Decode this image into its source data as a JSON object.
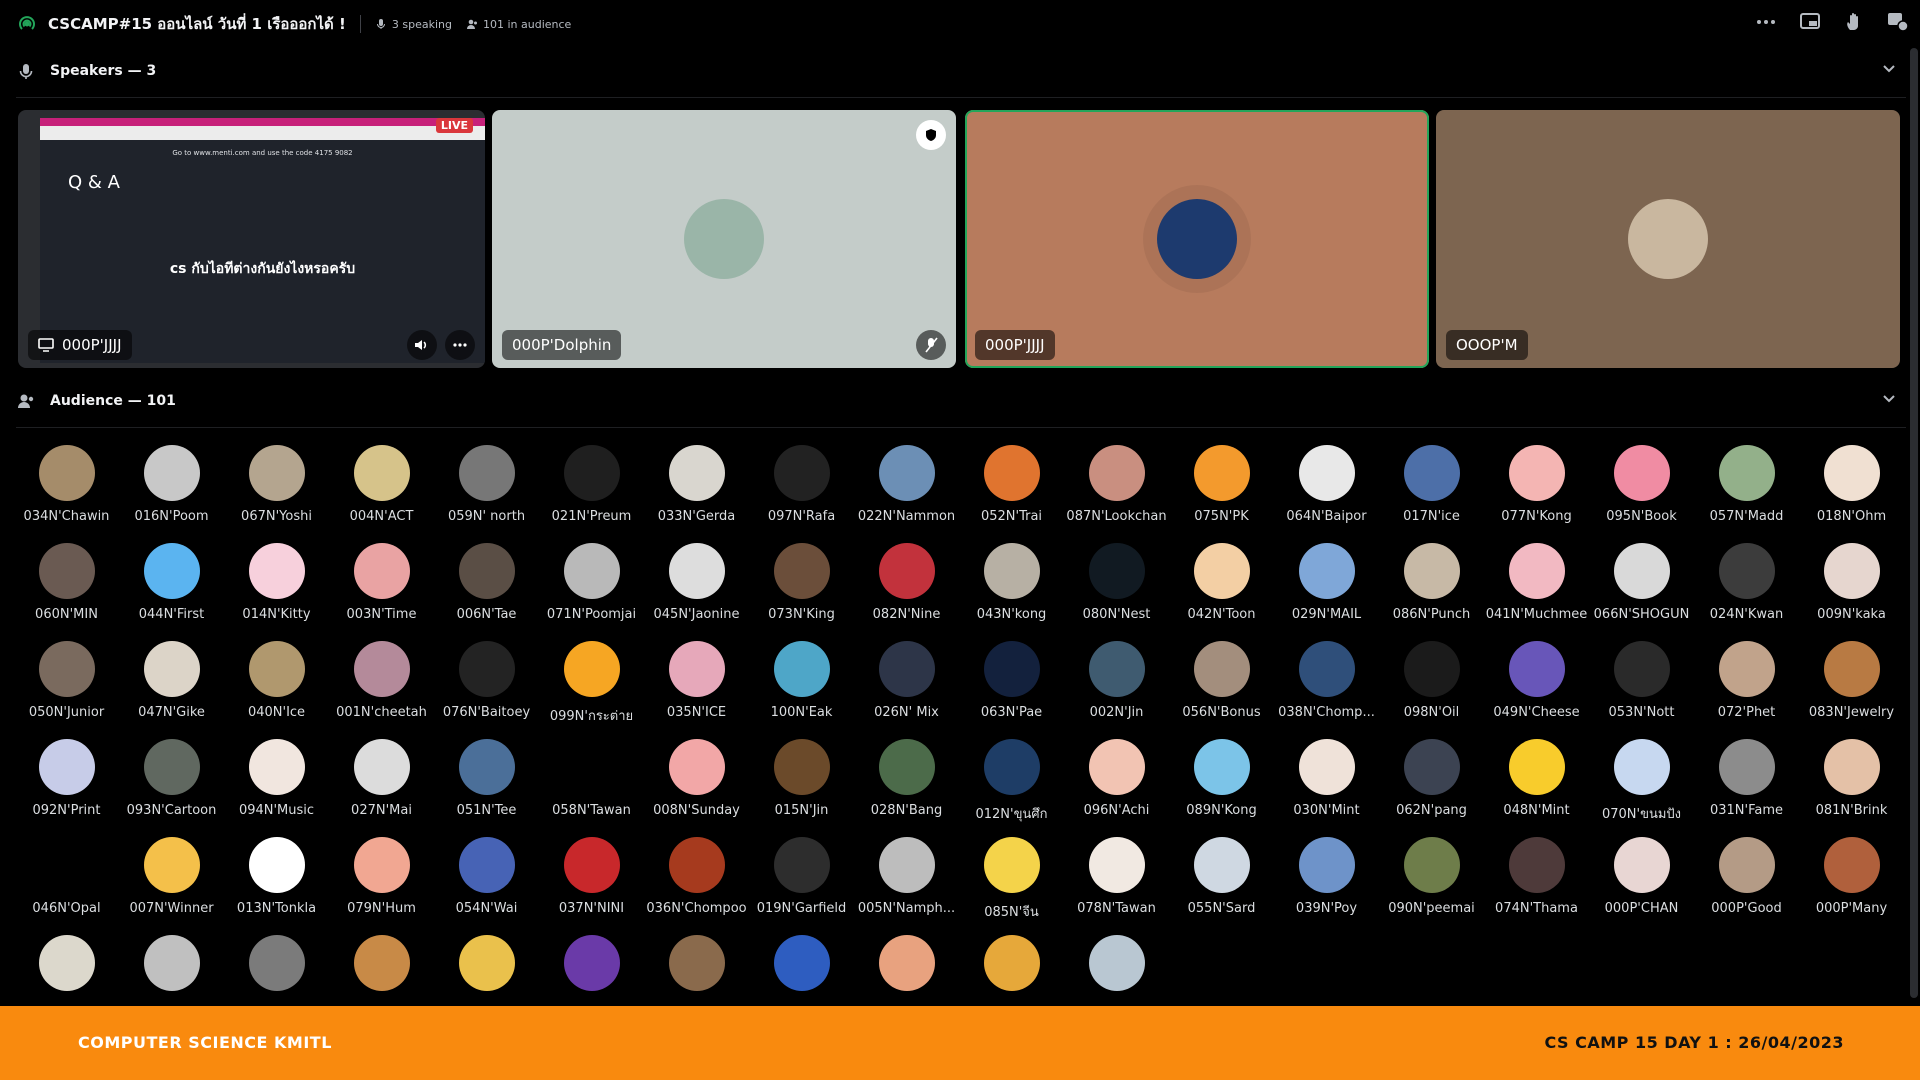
{
  "header": {
    "title": "CSCAMP#15 ออนไลน์ วันที่ 1 เรือออกได้ !",
    "speaking": "3 speaking",
    "audience": "101 in audience",
    "stage_icon": "stage-icon",
    "actions": [
      "more-icon",
      "popout-icon",
      "raise-hand-icon",
      "activity-icon"
    ]
  },
  "speakers": {
    "heading": "Speakers — 3",
    "tiles": [
      {
        "name": "000P'JJJJ",
        "kind": "screen-share",
        "live_badge": "LIVE",
        "slide_title": "Q & A",
        "slide_code": "Go to www.menti.com and use the code 4175 9082",
        "slide_question": "cs กับไอทีต่างกันยังไงหรอครับ",
        "bg": "#2b2d31"
      },
      {
        "name": "000P'Dolphin",
        "kind": "camera-off",
        "bg": "#c4ccc9",
        "avatar_color": "#9ab5a8"
      },
      {
        "name": "000P'JJJJ",
        "kind": "camera-off",
        "bg": "#b77b5d",
        "avatar_color": "#1d3a6e",
        "speaking": true
      },
      {
        "name": "OOOP'M",
        "kind": "camera-off",
        "bg": "#7d6550",
        "avatar_color": "#c9b79f"
      }
    ]
  },
  "audience": {
    "heading": "Audience — 101",
    "members": [
      {
        "name": "034N'Chawin",
        "color": "#a58c6a"
      },
      {
        "name": "016N'Poom",
        "color": "#c8c8c8"
      },
      {
        "name": "067N'Yoshi",
        "color": "#b4a58f"
      },
      {
        "name": "004N'ACT",
        "color": "#d6c38a"
      },
      {
        "name": "059N' north",
        "color": "#777777"
      },
      {
        "name": "021N'Preum",
        "color": "#1f1f1f"
      },
      {
        "name": "033N'Gerda",
        "color": "#d9d6cf"
      },
      {
        "name": "097N'Rafa",
        "color": "#222222"
      },
      {
        "name": "022N'Nammon",
        "color": "#6c8fb5"
      },
      {
        "name": "052N'Trai",
        "color": "#e0742f"
      },
      {
        "name": "087N'Lookchan",
        "color": "#c98f80"
      },
      {
        "name": "075N'PK",
        "color": "#f39a2d"
      },
      {
        "name": "064N'Baipor",
        "color": "#e8e8e8"
      },
      {
        "name": "017N'ice",
        "color": "#4d6fa8"
      },
      {
        "name": "077N'Kong",
        "color": "#f4b5b3"
      },
      {
        "name": "095N'Book",
        "color": "#f08ca3"
      },
      {
        "name": "057N'Madd",
        "color": "#93b08a"
      },
      {
        "name": "018N'Ohm",
        "color": "#f0e0d2"
      },
      {
        "name": "060N'MIN",
        "color": "#6a5a52"
      },
      {
        "name": "044N'First",
        "color": "#5bb4f0"
      },
      {
        "name": "014N'Kitty",
        "color": "#f7d0dc"
      },
      {
        "name": "003N'Time",
        "color": "#e9a3a3"
      },
      {
        "name": "006N'Tae",
        "color": "#5a4e45"
      },
      {
        "name": "071N'Poomjai",
        "color": "#b9b9b9"
      },
      {
        "name": "045N'Jaonine",
        "color": "#dddddd"
      },
      {
        "name": "073N'King",
        "color": "#6b4e3a"
      },
      {
        "name": "082N'Nine",
        "color": "#c2323c"
      },
      {
        "name": "043N'kong",
        "color": "#b7b0a4"
      },
      {
        "name": "080N'Nest",
        "color": "#111a22"
      },
      {
        "name": "042N'Toon",
        "color": "#f3cfa4"
      },
      {
        "name": "029N'MAIL",
        "color": "#7fa7d8"
      },
      {
        "name": "086N'Punch",
        "color": "#c7b9a6"
      },
      {
        "name": "041N'Muchmee",
        "color": "#f2b9c2"
      },
      {
        "name": "066N'SHOGUN",
        "color": "#d9d9d9"
      },
      {
        "name": "024N'Kwan",
        "color": "#3c3c3c"
      },
      {
        "name": "009N'kaka",
        "color": "#e6d6cf"
      },
      {
        "name": "050N'Junior",
        "color": "#7a6a5e"
      },
      {
        "name": "047N'Gike",
        "color": "#dcd4c8"
      },
      {
        "name": "040N'Ice",
        "color": "#b0986e"
      },
      {
        "name": "001N'cheetah",
        "color": "#b48a9a"
      },
      {
        "name": "076N'Baitoey",
        "color": "#232323"
      },
      {
        "name": "099N'กระต่าย",
        "color": "#f6a623"
      },
      {
        "name": "035N'ICE",
        "color": "#e6a8ba"
      },
      {
        "name": "100N'Eak",
        "color": "#4ea6c8"
      },
      {
        "name": "026N' Mix",
        "color": "#2d3548"
      },
      {
        "name": "063N'Pae",
        "color": "#13213d"
      },
      {
        "name": "002N'Jin",
        "color": "#3f5b70"
      },
      {
        "name": "056N'Bonus",
        "color": "#a38e7d"
      },
      {
        "name": "038N'Chomp...",
        "color": "#2f4f7a"
      },
      {
        "name": "098N'Oil",
        "color": "#1b1b1b"
      },
      {
        "name": "049N'Cheese",
        "color": "#6856b9"
      },
      {
        "name": "053N'Nott",
        "color": "#2a2a2a"
      },
      {
        "name": "072'Phet",
        "color": "#c1a38b"
      },
      {
        "name": "083N'Jewelry",
        "color": "#b87a43"
      },
      {
        "name": "092N'Print",
        "color": "#c7cce8"
      },
      {
        "name": "093N'Cartoon",
        "color": "#606860"
      },
      {
        "name": "094N'Music",
        "color": "#f1e6df"
      },
      {
        "name": "027N'Mai",
        "color": "#dcdcdc"
      },
      {
        "name": "051N'Tee",
        "color": "#4b6f99"
      },
      {
        "name": "058N'Tawan",
        "color": "#000000"
      },
      {
        "name": "008N'Sunday",
        "color": "#f2a7a7"
      },
      {
        "name": "015N'Jin",
        "color": "#6b4a2a"
      },
      {
        "name": "028N'Bang",
        "color": "#4c6b4a"
      },
      {
        "name": "012N'ขุนศึก",
        "color": "#1e3d66"
      },
      {
        "name": "096N'Achi",
        "color": "#f2c4b3"
      },
      {
        "name": "089N'Kong",
        "color": "#7cc4e8"
      },
      {
        "name": "030N'Mint",
        "color": "#efe2d9"
      },
      {
        "name": "062N'pang",
        "color": "#3c4352"
      },
      {
        "name": "048N'Mint",
        "color": "#f8cc2c"
      },
      {
        "name": "070N'ขนมปัง",
        "color": "#c7d8f0"
      },
      {
        "name": "031N'Fame",
        "color": "#8c8c8c"
      },
      {
        "name": "081N'Brink",
        "color": "#e4c1a7"
      },
      {
        "name": "046N'Opal",
        "color": "#000000"
      },
      {
        "name": "007N'Winner",
        "color": "#f4c04a"
      },
      {
        "name": "013N'Tonkla",
        "color": "#ffffff"
      },
      {
        "name": "079N'Hum",
        "color": "#f1a792"
      },
      {
        "name": "054N'Wai",
        "color": "#4763b5"
      },
      {
        "name": "037N'NINI",
        "color": "#c8282b"
      },
      {
        "name": "036N'Chompoo",
        "color": "#a63a1e"
      },
      {
        "name": "019N'Garfield",
        "color": "#2d2d2d"
      },
      {
        "name": "005N'Namph...",
        "color": "#bdbdbd"
      },
      {
        "name": "085N'จีน",
        "color": "#f4d34a"
      },
      {
        "name": "078N'Tawan",
        "color": "#f1e9e2"
      },
      {
        "name": "055N'Sard",
        "color": "#cfd8e2"
      },
      {
        "name": "039N'Poy",
        "color": "#6e93c9"
      },
      {
        "name": "090N'peemai",
        "color": "#6e7d4a"
      },
      {
        "name": "074N'Thama",
        "color": "#4e3a3a"
      },
      {
        "name": "000P'CHAN",
        "color": "#e8d6d3"
      },
      {
        "name": "000P'Good",
        "color": "#b49b86"
      },
      {
        "name": "000P'Many",
        "color": "#b0603c"
      },
      {
        "name": "",
        "color": "#dcd8cc"
      },
      {
        "name": "",
        "color": "#c0c0c0"
      },
      {
        "name": "",
        "color": "#7b7b7b"
      },
      {
        "name": "",
        "color": "#c88a47"
      },
      {
        "name": "",
        "color": "#eac14c"
      },
      {
        "name": "",
        "color": "#6a3aa8"
      },
      {
        "name": "",
        "color": "#8a6a4c"
      },
      {
        "name": "",
        "color": "#2e5dc0"
      },
      {
        "name": "",
        "color": "#e8a27f"
      },
      {
        "name": "",
        "color": "#e6a83a"
      },
      {
        "name": "",
        "color": "#b9c7d2"
      }
    ]
  },
  "footer": {
    "left": "COMPUTER SCIENCE KMITL",
    "right": "CS CAMP 15 DAY 1 : 26/04/2023"
  }
}
